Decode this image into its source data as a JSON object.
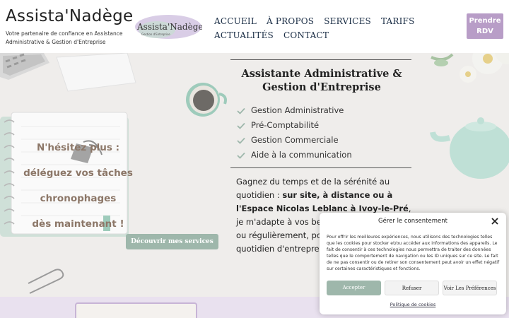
{
  "header": {
    "site_title": "Assista'Nadège",
    "tagline": "Votre partenaire de confiance en Assistance Administrative & Gestion d'Entreprise",
    "logo_text": "Assista'Nadège",
    "logo_subtext": "Gestion d'Entreprise",
    "nav": [
      "ACCUEIL",
      "À PROPOS",
      "SERVICES",
      "TARIFS",
      "ACTUALITÉS",
      "CONTACT"
    ],
    "cta_label_line1": "Prendre",
    "cta_label_line2": "RDV"
  },
  "hero": {
    "cta_lines": [
      "N'hésitez plus :",
      "déléguez vos tâches",
      "chronophages",
      "dès maintenant !"
    ],
    "discover_button": "Découvrir mes services",
    "title_line1": "Assistante Administrative &",
    "title_line2": "Gestion d'Entreprise",
    "services": [
      "Gestion Administrative",
      "Pré-Comptabilité",
      "Gestion Commerciale",
      "Aide à la communication"
    ],
    "intro_before": "Gagnez du temps et de la sérénité au quotidien : ",
    "intro_bold": "sur site, à distance ou à l'Espace Nicolas Leblanc à Ivoy-le-Pré",
    "intro_after": ", je m'adapte à vos besoins ponctuellement ou régulièrement, pour vous faciliter le quotidien d'entreprene"
  },
  "cookie": {
    "title": "Gérer le consentement",
    "body": "Pour offrir les meilleures expériences, nous utilisons des technologies telles que les cookies pour stocker et/ou accéder aux informations des appareils. Le fait de consentir à ces technologies nous permettra de traiter des données telles que le comportement de navigation ou les ID uniques sur ce site. Le fait de ne pas consentir ou de retirer son consentement peut avoir un effet négatif sur certaines caractéristiques et fonctions.",
    "accept": "Accepter",
    "refuse": "Refuser",
    "preferences": "Voir Les Préférences",
    "policy_link": "Politique de cookies"
  },
  "colors": {
    "accent_purple": "#b89dc7",
    "accent_sage": "#9eb7ab",
    "cta_text_brown": "#8c7768",
    "nav_navy": "#1a2d45"
  }
}
